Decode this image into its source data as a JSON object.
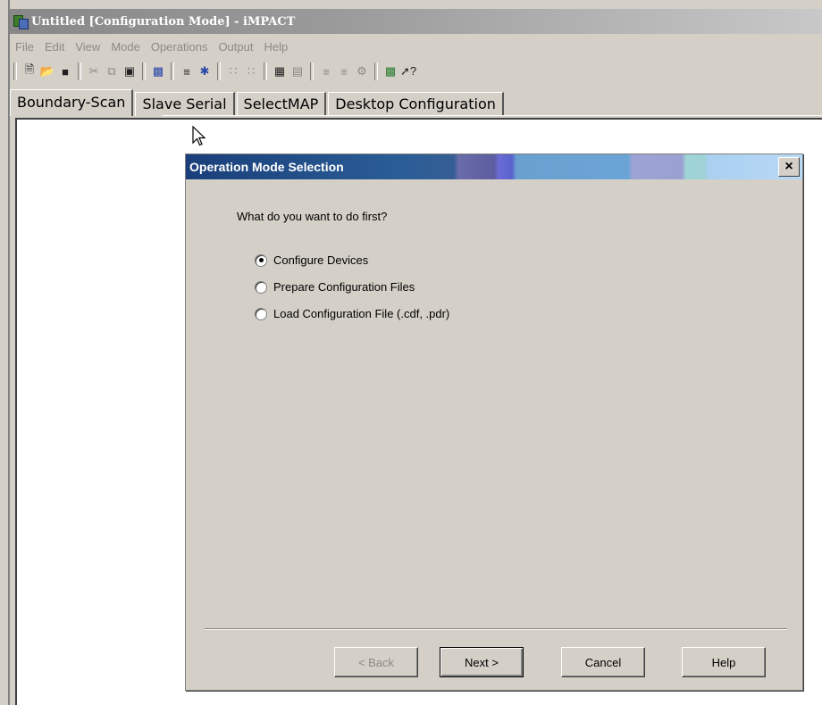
{
  "window": {
    "title": "Untitled [Configuration Mode] - iMPACT"
  },
  "menu": [
    "File",
    "Edit",
    "View",
    "Mode",
    "Operations",
    "Output",
    "Help"
  ],
  "toolbar": {
    "icons": [
      "new-file-icon",
      "open-folder-icon",
      "save-icon",
      "cut-icon",
      "copy-icon",
      "paste-icon",
      "program-icon",
      "initialize-chain-icon",
      "debug-chain-icon",
      "grid-small-icon",
      "grid-large-icon",
      "chip-icon",
      "chip-list-icon",
      "chain-icon",
      "chain-alt-icon",
      "gear-icon",
      "device-icon",
      "help-cursor-icon"
    ]
  },
  "tabs": [
    "Boundary-Scan",
    "Slave Serial",
    "SelectMAP",
    "Desktop Configuration"
  ],
  "dialog": {
    "title": "Operation Mode Selection",
    "close_label": "×",
    "question": "What do you want to do first?",
    "options": [
      {
        "label": "Configure Devices",
        "selected": true
      },
      {
        "label": "Prepare Configuration Files",
        "selected": false
      },
      {
        "label": "Load Configuration File (.cdf, .pdr)",
        "selected": false
      }
    ],
    "buttons": {
      "back": "< Back",
      "next": "Next >",
      "cancel": "Cancel",
      "help": "Help"
    }
  },
  "colors": {
    "face": "#d4d0c8",
    "title_start": "#1a3f7a",
    "title_end": "#b8daf6",
    "disabled_text": "#8c8a85"
  }
}
